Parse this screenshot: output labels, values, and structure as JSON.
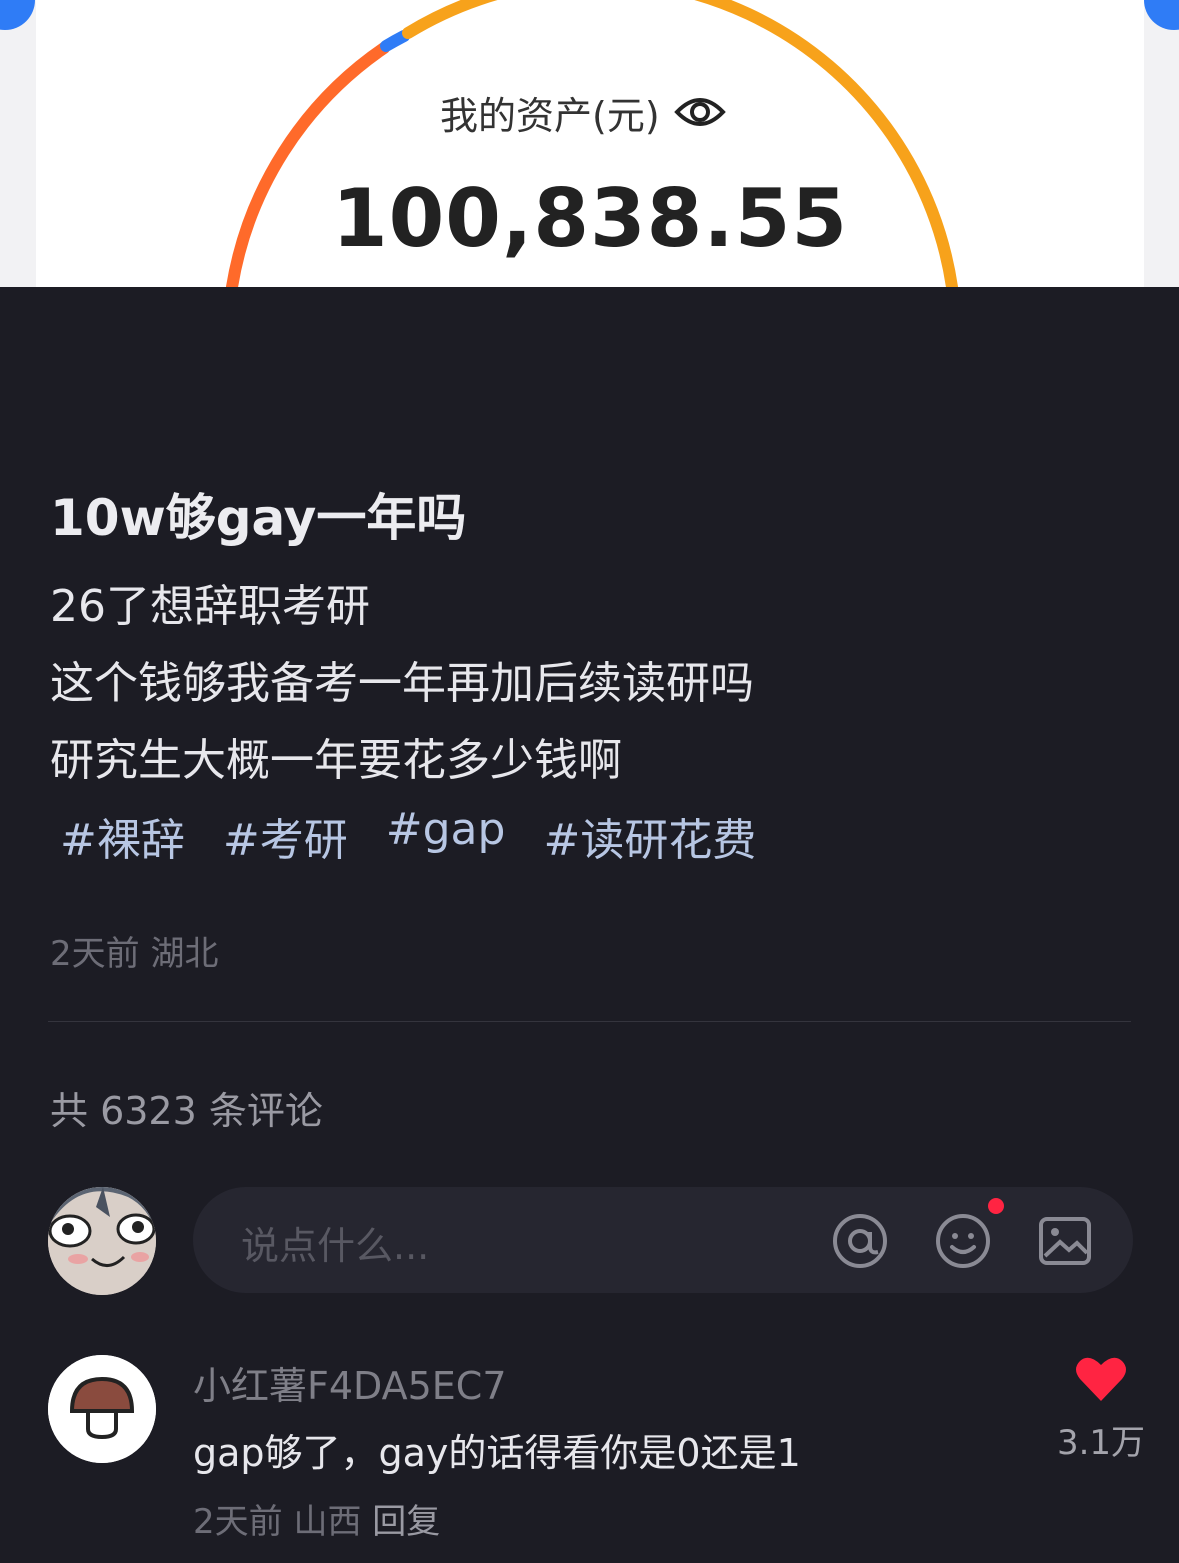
{
  "asset_screenshot": {
    "label": "我的资产(元)",
    "amount": "100,838.55",
    "ring_colors": [
      "#ff6a2a",
      "#f7a21b",
      "#2f7cf6"
    ]
  },
  "post": {
    "title": "10w够gay一年吗",
    "body_lines": [
      "26了想辞职考研",
      "这个钱够我备考一年再加后续读研吗",
      "研究生大概一年要花多少钱啊"
    ],
    "tags": [
      "#裸辞",
      "#考研",
      "#gap",
      "#读研花费"
    ],
    "time": "2天前",
    "location": "湖北"
  },
  "comments_header": {
    "count_text": "共 6323 条评论"
  },
  "comment_input": {
    "placeholder": "说点什么...",
    "icons": [
      "at-icon",
      "emoji-icon",
      "image-icon"
    ],
    "notification_color": "#ff2442"
  },
  "comments": [
    {
      "user": "小红薯F4DA5EC7",
      "text": "gap够了，gay的话得看你是0还是1",
      "time": "2天前",
      "location": "山西",
      "reply_label": "回复",
      "likes": "3.1万",
      "like_color": "#ff2442"
    }
  ]
}
